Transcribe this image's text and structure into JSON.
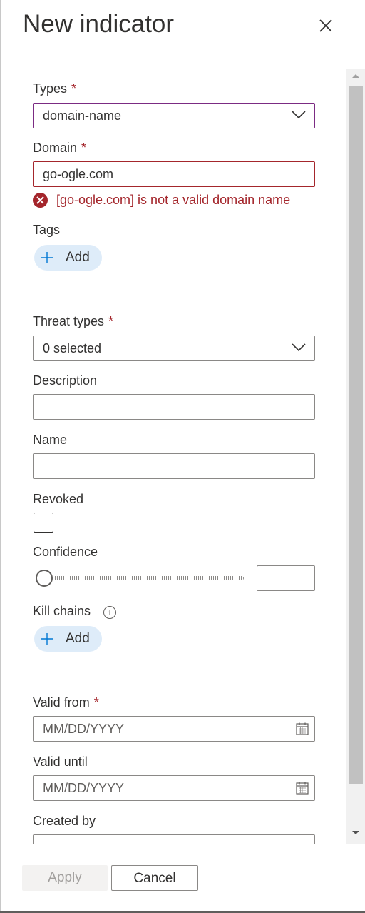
{
  "panel": {
    "title": "New indicator"
  },
  "form": {
    "types": {
      "label": "Types",
      "required": "*",
      "value": "domain-name"
    },
    "domain": {
      "label": "Domain",
      "required": "*",
      "value": "go-ogle.com",
      "error": "[go-ogle.com] is not a valid domain name"
    },
    "tags": {
      "label": "Tags",
      "add_label": "Add"
    },
    "threat_types": {
      "label": "Threat types",
      "required": "*",
      "value": "0 selected"
    },
    "description": {
      "label": "Description",
      "value": ""
    },
    "name": {
      "label": "Name",
      "value": ""
    },
    "revoked": {
      "label": "Revoked",
      "checked": false
    },
    "confidence": {
      "label": "Confidence",
      "value": 0,
      "input_value": ""
    },
    "kill_chains": {
      "label": "Kill chains",
      "info": "i",
      "add_label": "Add"
    },
    "valid_from": {
      "label": "Valid from",
      "required": "*",
      "placeholder": "MM/DD/YYYY"
    },
    "valid_until": {
      "label": "Valid until",
      "placeholder": "MM/DD/YYYY"
    },
    "created_by": {
      "label": "Created by"
    }
  },
  "footer": {
    "apply_label": "Apply",
    "cancel_label": "Cancel"
  },
  "icons": {
    "close": "close-icon",
    "chevron": "chevron-down-icon",
    "error": "error-icon",
    "add": "plus-icon",
    "calendar": "calendar-icon",
    "info": "info-icon"
  },
  "colors": {
    "error": "#a4262c",
    "focus_border": "#7b2b83",
    "pill_bg": "#deecf9"
  }
}
